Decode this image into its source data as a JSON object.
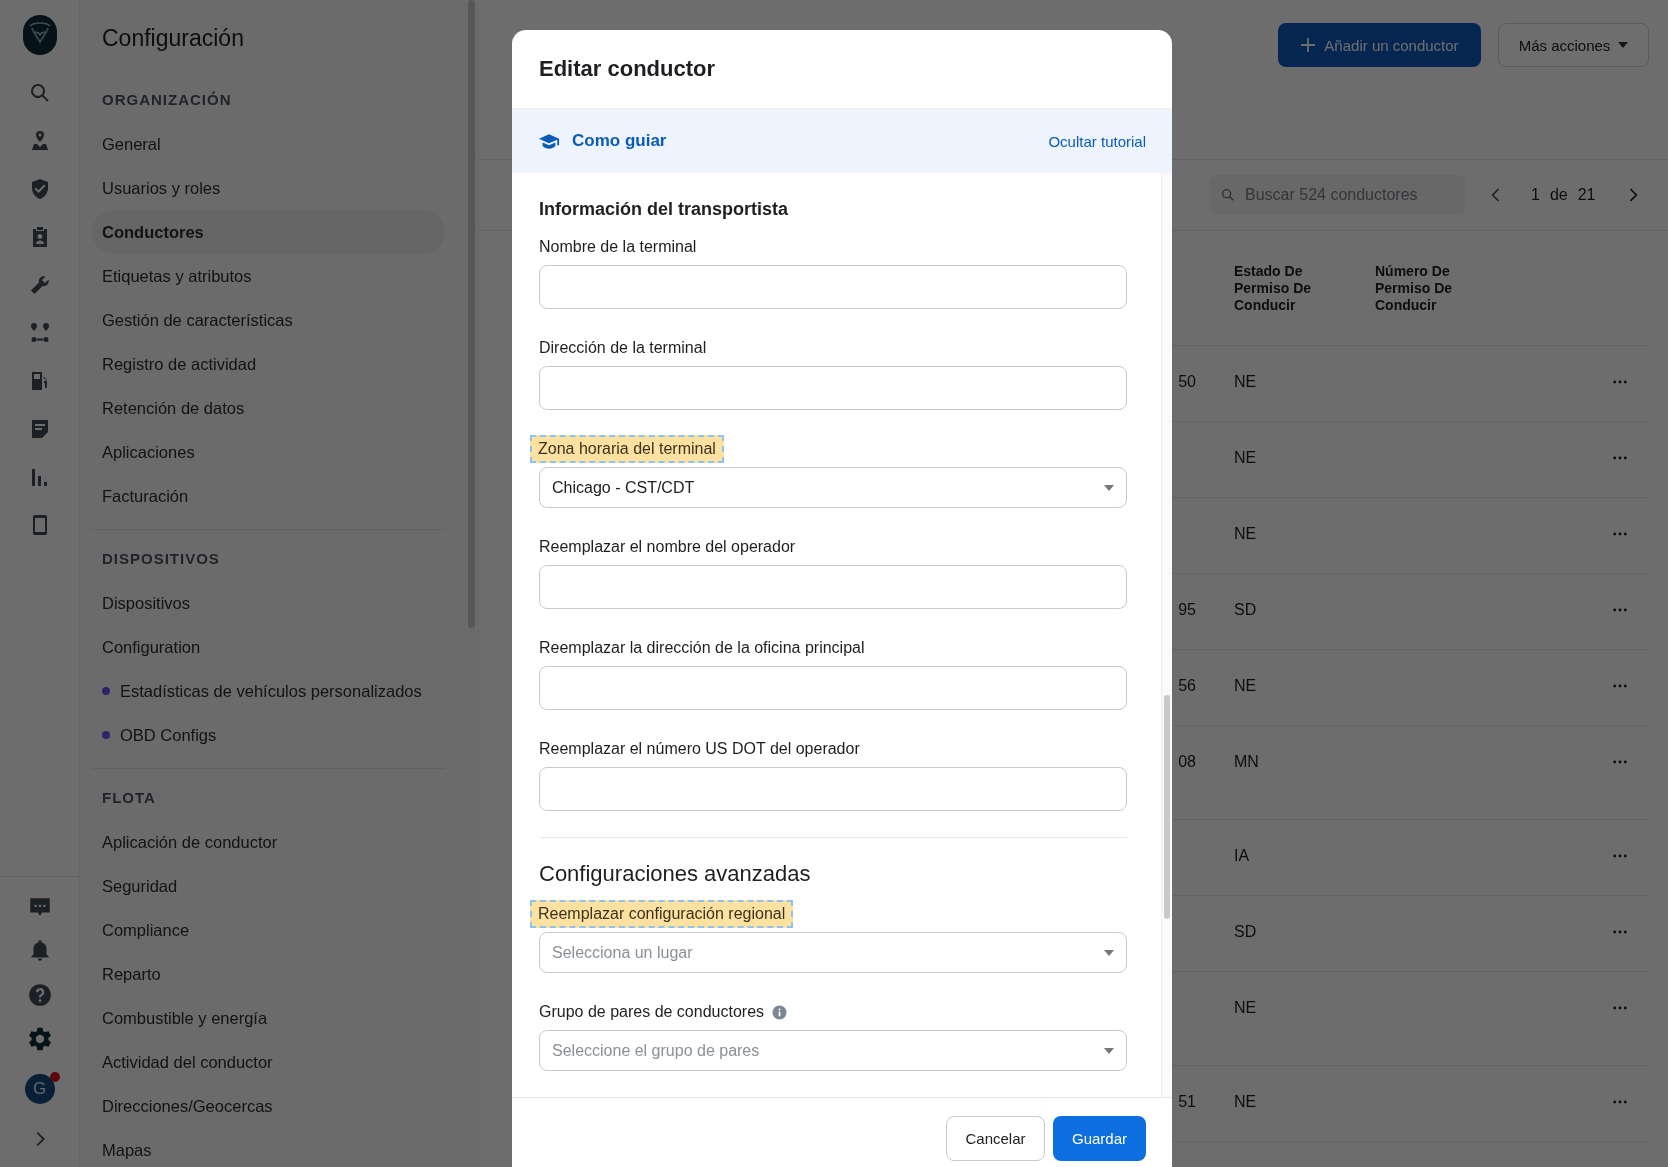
{
  "rail": {
    "avatar": {
      "initial": "G",
      "notification": true
    }
  },
  "sidebar": {
    "title": "Configuración",
    "sections": [
      {
        "heading": "ORGANIZACIÓN",
        "items": [
          {
            "label": "General",
            "selected": false
          },
          {
            "label": "Usuarios y roles",
            "selected": false
          },
          {
            "label": "Conductores",
            "selected": true
          },
          {
            "label": "Etiquetas y atributos",
            "selected": false
          },
          {
            "label": "Gestión de características",
            "selected": false
          },
          {
            "label": "Registro de actividad",
            "selected": false
          },
          {
            "label": "Retención de datos",
            "selected": false
          },
          {
            "label": "Aplicaciones",
            "selected": false
          },
          {
            "label": "Facturación",
            "selected": false
          }
        ]
      },
      {
        "heading": "DISPOSITIVOS",
        "items": [
          {
            "label": "Dispositivos",
            "selected": false
          },
          {
            "label": "Configuration",
            "selected": false
          },
          {
            "label": "Estadísticas de vehículos personalizados",
            "selected": false,
            "color": "#2e2468"
          },
          {
            "label": "OBD Configs",
            "selected": false,
            "color": "#2e2468"
          }
        ]
      },
      {
        "heading": "FLOTA",
        "items": [
          {
            "label": "Aplicación de conductor",
            "selected": false
          },
          {
            "label": "Seguridad",
            "selected": false
          },
          {
            "label": "Compliance",
            "selected": false
          },
          {
            "label": "Reparto",
            "selected": false
          },
          {
            "label": "Combustible y energía",
            "selected": false
          },
          {
            "label": "Actividad del conductor",
            "selected": false
          },
          {
            "label": "Direcciones/Geocercas",
            "selected": false
          },
          {
            "label": "Mapas",
            "selected": false
          }
        ]
      }
    ]
  },
  "header_buttons": [
    {
      "label": "Añadir un conductor",
      "kind": "primary"
    },
    {
      "label": "Más acciones",
      "kind": "dropdown"
    }
  ],
  "search": {
    "placeholder": "Buscar 524 conductores"
  },
  "pagination": {
    "page": "1",
    "separator": "de",
    "total": "21"
  },
  "table": {
    "columns": [
      "Estado De Permiso De Conducir",
      "Número De Permiso De Conducir"
    ],
    "rows": [
      {
        "column_1": "50",
        "license_state": "NE"
      },
      {
        "license_state": "NE"
      },
      {
        "license_state": "NE"
      },
      {
        "column_1": "95",
        "license_state": "SD"
      },
      {
        "column_1": "56",
        "license_state": "NE"
      },
      {
        "column_1": "08",
        "license_state": "MN"
      },
      {
        "license_state": "IA"
      },
      {
        "license_state": "SD"
      },
      {
        "license_state": "NE"
      },
      {
        "column_1": "51",
        "license_state": "NE"
      }
    ]
  },
  "modal": {
    "title": "Editar conductor",
    "tutorial": {
      "title": "Como guiar",
      "hide_link": "Ocultar tutorial"
    },
    "sections": [
      {
        "heading": "Información del transportista",
        "kind": "bold",
        "fields": [
          {
            "label": "Nombre de la terminal",
            "kind": "text",
            "highlighted": false,
            "info": false
          },
          {
            "label": "Dirección de la terminal",
            "kind": "text",
            "highlighted": false,
            "info": false
          },
          {
            "label": "Zona horaria del terminal",
            "kind": "select",
            "highlighted": true,
            "info": false,
            "value": "Chicago - CST/CDT"
          },
          {
            "label": "Reemplazar el nombre del operador",
            "kind": "text",
            "highlighted": false,
            "info": false
          },
          {
            "label": "Reemplazar la dirección de la oficina principal",
            "kind": "text",
            "highlighted": false,
            "info": false
          },
          {
            "label": "Reemplazar el número US DOT del operador",
            "kind": "text",
            "highlighted": false,
            "info": false
          }
        ]
      },
      {
        "heading": "Configuraciones avanzadas",
        "kind": "large",
        "fields": [
          {
            "label": "Reemplazar configuración regional",
            "kind": "select",
            "highlighted": true,
            "info": false,
            "placeholder": "Selecciona un lugar"
          },
          {
            "label": "Grupo de pares de conductores",
            "kind": "select",
            "highlighted": false,
            "info": true,
            "placeholder": "Seleccione el grupo de pares"
          }
        ]
      }
    ],
    "buttons": [
      {
        "label": "Cancelar",
        "kind": "secondary"
      },
      {
        "label": "Guardar",
        "kind": "primary"
      }
    ]
  }
}
